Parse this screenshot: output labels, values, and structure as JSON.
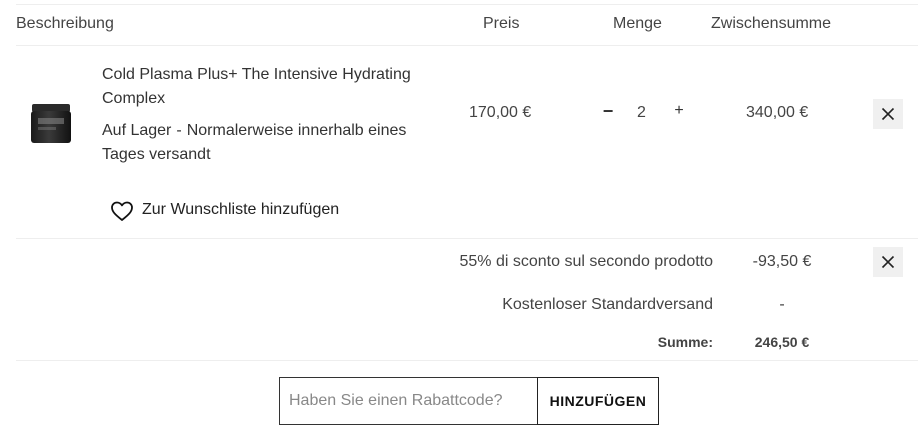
{
  "table_header": {
    "description": "Beschreibung",
    "price": "Preis",
    "quantity": "Menge",
    "subtotal": "Zwischensumme"
  },
  "item": {
    "name": "Cold Plasma Plus+ The Intensive Hydrating Complex",
    "stock_status": "Auf Lager",
    "separator": "-",
    "shipping_note": "Normalerweise innerhalb eines Tages versandt",
    "price": "170,00 €",
    "quantity": "2",
    "qty_minus": "−",
    "qty_plus": "+",
    "subtotal": "340,00 €",
    "image_icon": "product-jar-image",
    "remove_icon": "close-icon"
  },
  "wishlist": {
    "label": "Zur Wunschliste hinzufügen",
    "icon": "heart-icon"
  },
  "summary": {
    "discount_label": "55% di sconto sul secondo prodotto",
    "discount_value": "-93,50 €",
    "shipping_label": "Kostenloser Standardversand",
    "shipping_value": "-",
    "total_label": "Summe:",
    "total_value": "246,50 €"
  },
  "coupon": {
    "placeholder": "Haben Sie einen Rabattcode?",
    "value": "",
    "button_label": "HINZUFÜGEN"
  },
  "colors": {
    "text": "#333333",
    "divider": "#eeeeee",
    "remove_bg": "#f0f0f0",
    "border": "#222222"
  }
}
